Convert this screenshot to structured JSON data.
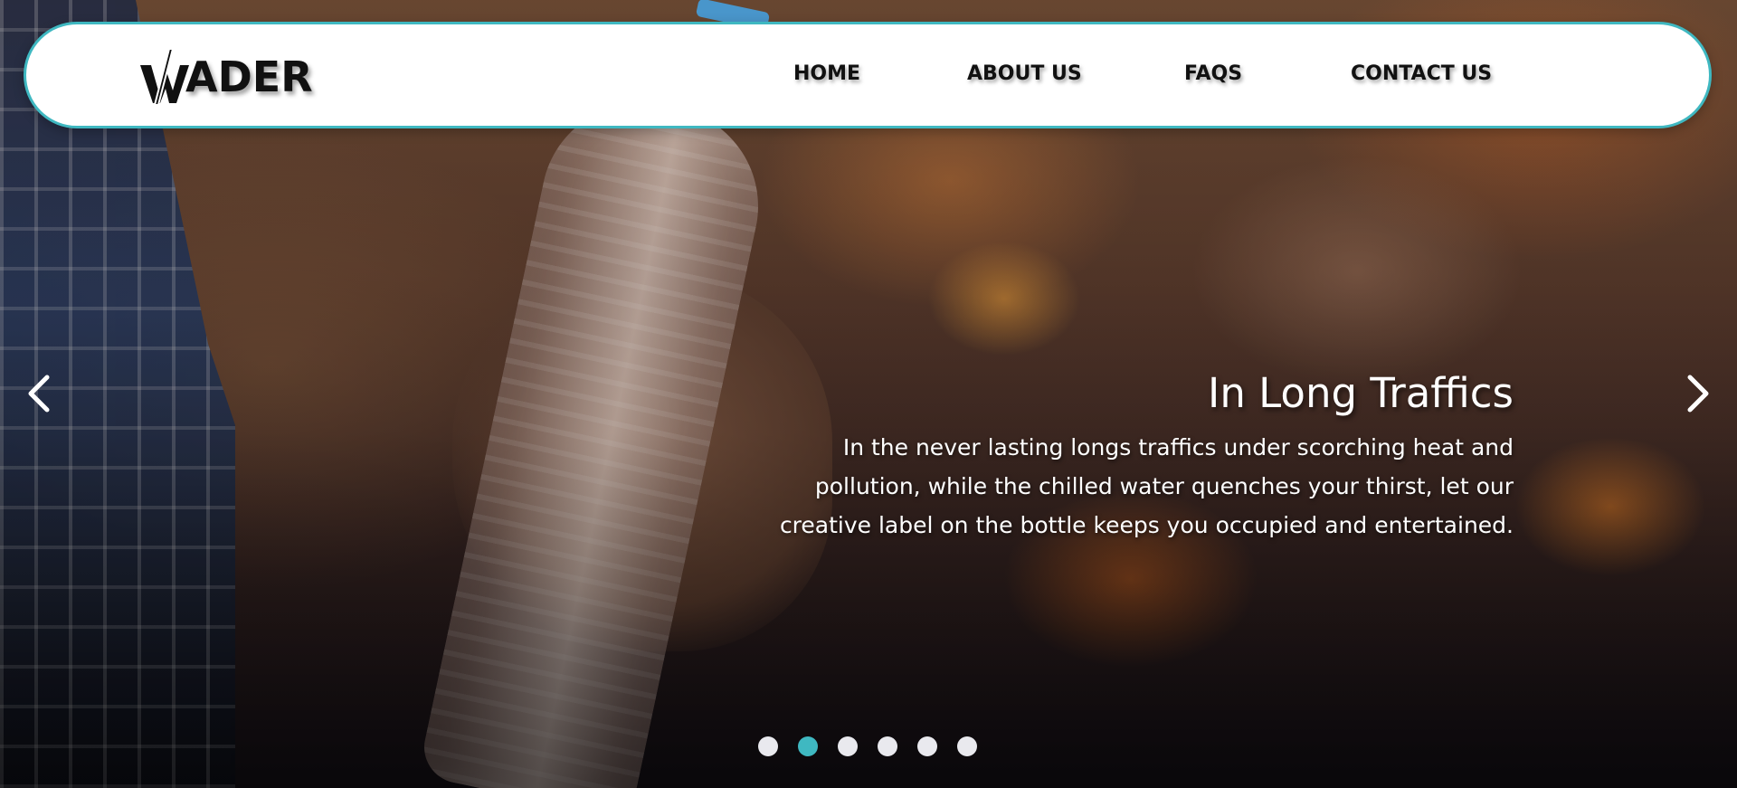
{
  "brand": {
    "logo_text": "ADER",
    "logo_mark": "W-lightning-icon"
  },
  "nav": {
    "items": [
      {
        "label": "HOME"
      },
      {
        "label": "ABOUT US"
      },
      {
        "label": "FAQS"
      },
      {
        "label": "CONTACT US"
      }
    ]
  },
  "carousel": {
    "slide": {
      "title": "In Long Traffics",
      "text": "In the never lasting longs traffics under scorching heat and pollution, while the chilled water quenches your thirst, let our creative label on the bottle keeps you occupied and entertained."
    },
    "prev_icon": "chevron-left-icon",
    "next_icon": "chevron-right-icon",
    "indicator_count": 6,
    "active_index": 1
  },
  "colors": {
    "accent": "#3fb8c1",
    "nav_bg": "#ffffff",
    "text_dark": "#111111",
    "indicator_inactive": "#e9e9ee"
  }
}
